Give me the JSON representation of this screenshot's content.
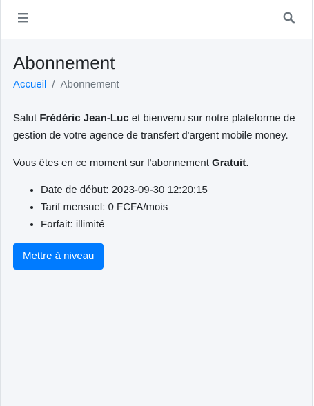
{
  "navbar": {
    "menu_icon": "hamburger-menu-icon",
    "search_icon": "search-icon"
  },
  "page": {
    "title": "Abonnement"
  },
  "breadcrumb": {
    "home": "Accueil",
    "separator": "/",
    "current": "Abonnement"
  },
  "welcome": {
    "prefix": "Salut ",
    "user_name": "Frédéric Jean-Luc",
    "suffix": " et bienvenu sur notre plateforme de gestion de votre agence de transfert d'argent mobile money."
  },
  "subscription": {
    "prefix": "Vous êtes en ce moment sur l'abonnement ",
    "plan": "Gratuit",
    "suffix": ".",
    "details": [
      "Date de début: 2023-09-30 12:20:15",
      "Tarif mensuel: 0 FCFA/mois",
      "Forfait: illimité"
    ]
  },
  "actions": {
    "upgrade_label": "Mettre à niveau"
  },
  "colors": {
    "primary": "#007bff",
    "background": "#f4f6f9",
    "navbar_icon": "#6c757d"
  }
}
